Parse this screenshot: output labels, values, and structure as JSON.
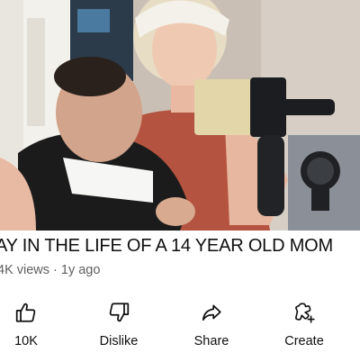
{
  "video": {
    "title": "AY IN THE LIFE OF A 14 YEAR OLD MOM",
    "views": "4K views",
    "age": "1y ago",
    "separator": "·"
  },
  "actions": [
    {
      "label": "10K",
      "icon": "thumbs-up-icon"
    },
    {
      "label": "Dislike",
      "icon": "thumbs-down-icon"
    },
    {
      "label": "Share",
      "icon": "share-icon"
    },
    {
      "label": "Create",
      "icon": "create-icon"
    }
  ],
  "colors": {
    "text": "#0f0f0f",
    "meta": "#606060",
    "background": "#ffffff"
  }
}
